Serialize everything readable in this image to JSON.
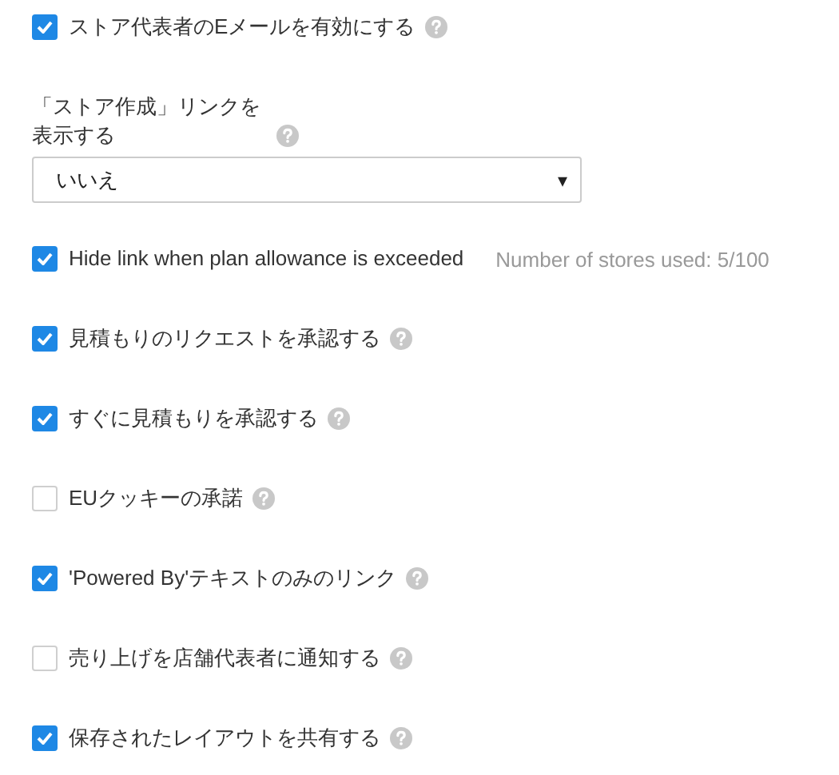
{
  "settings": [
    {
      "kind": "checkbox",
      "label": "ストア代表者のEメールを有効にする",
      "checked": true,
      "help": true
    },
    {
      "kind": "select",
      "label": "「ストア作成」リンクを表示する",
      "help": true,
      "value": "いいえ",
      "caret": "▾"
    },
    {
      "kind": "checkbox",
      "label": "Hide link when plan allowance is exceeded",
      "checked": true,
      "help": false,
      "note": "Number of stores used: 5/100"
    },
    {
      "kind": "checkbox",
      "label": "見積もりのリクエストを承認する",
      "checked": true,
      "help": true
    },
    {
      "kind": "checkbox",
      "label": "すぐに見積もりを承認する",
      "checked": true,
      "help": true
    },
    {
      "kind": "checkbox",
      "label": "EUクッキーの承諾",
      "checked": false,
      "help": true
    },
    {
      "kind": "checkbox",
      "label": "'Powered By'テキストのみのリンク",
      "checked": true,
      "help": true
    },
    {
      "kind": "checkbox",
      "label": "売り上げを店舗代表者に通知する",
      "checked": false,
      "help": true
    },
    {
      "kind": "checkbox",
      "label": "保存されたレイアウトを共有する",
      "checked": true,
      "help": true
    }
  ]
}
